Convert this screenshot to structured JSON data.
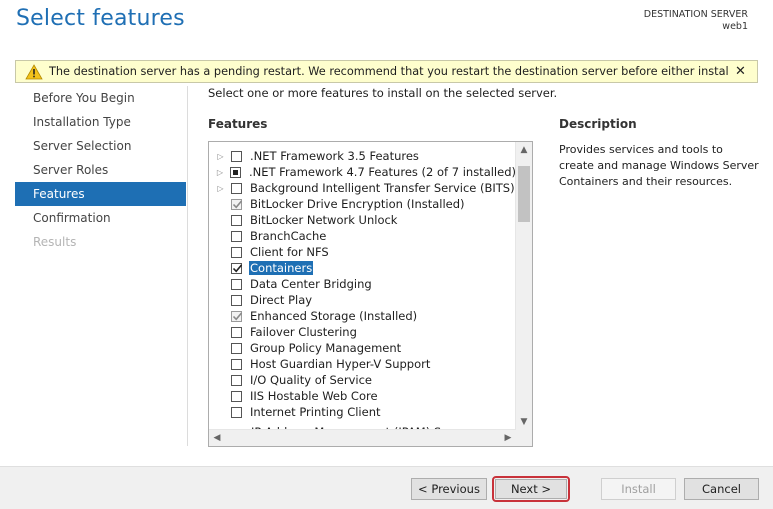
{
  "header": {
    "title": "Select features",
    "destination_label": "DESTINATION SERVER",
    "destination_server": "web1"
  },
  "warning": {
    "icon": "warning-icon",
    "text": "The destination server has a pending restart. We recommend that you restart the destination server before either installing or...",
    "close_label": "✕"
  },
  "nav": {
    "items": [
      {
        "label": "Before You Begin",
        "state": "normal"
      },
      {
        "label": "Installation Type",
        "state": "normal"
      },
      {
        "label": "Server Selection",
        "state": "normal"
      },
      {
        "label": "Server Roles",
        "state": "normal"
      },
      {
        "label": "Features",
        "state": "active"
      },
      {
        "label": "Confirmation",
        "state": "normal"
      },
      {
        "label": "Results",
        "state": "disabled"
      }
    ]
  },
  "main": {
    "instruction": "Select one or more features to install on the selected server.",
    "features_heading": "Features",
    "description_heading": "Description",
    "description_text": "Provides services and tools to create and manage Windows Server Containers and their resources.",
    "features": [
      {
        "label": ".NET Framework 3.5 Features",
        "expandable": true,
        "check": "unchecked",
        "selected": false
      },
      {
        "label": ".NET Framework 4.7 Features (2 of 7 installed)",
        "expandable": true,
        "check": "partial",
        "selected": false
      },
      {
        "label": "Background Intelligent Transfer Service (BITS)",
        "expandable": true,
        "check": "unchecked",
        "selected": false
      },
      {
        "label": "BitLocker Drive Encryption (Installed)",
        "expandable": false,
        "check": "installed",
        "selected": false
      },
      {
        "label": "BitLocker Network Unlock",
        "expandable": false,
        "check": "unchecked",
        "selected": false
      },
      {
        "label": "BranchCache",
        "expandable": false,
        "check": "unchecked",
        "selected": false
      },
      {
        "label": "Client for NFS",
        "expandable": false,
        "check": "unchecked",
        "selected": false
      },
      {
        "label": "Containers",
        "expandable": false,
        "check": "checked",
        "selected": true
      },
      {
        "label": "Data Center Bridging",
        "expandable": false,
        "check": "unchecked",
        "selected": false
      },
      {
        "label": "Direct Play",
        "expandable": false,
        "check": "unchecked",
        "selected": false
      },
      {
        "label": "Enhanced Storage (Installed)",
        "expandable": false,
        "check": "installed",
        "selected": false
      },
      {
        "label": "Failover Clustering",
        "expandable": false,
        "check": "unchecked",
        "selected": false
      },
      {
        "label": "Group Policy Management",
        "expandable": false,
        "check": "unchecked",
        "selected": false
      },
      {
        "label": "Host Guardian Hyper-V Support",
        "expandable": false,
        "check": "unchecked",
        "selected": false
      },
      {
        "label": "I/O Quality of Service",
        "expandable": false,
        "check": "unchecked",
        "selected": false
      },
      {
        "label": "IIS Hostable Web Core",
        "expandable": false,
        "check": "unchecked",
        "selected": false
      },
      {
        "label": "Internet Printing Client",
        "expandable": false,
        "check": "unchecked",
        "selected": false
      }
    ],
    "cut_off_row": "IP Address Management (IPAM) Server"
  },
  "footer": {
    "previous_label": "< Previous",
    "next_label": "Next >",
    "install_label": "Install",
    "cancel_label": "Cancel"
  },
  "colors": {
    "title": "#1f6fb4",
    "accent": "#1e6fb4",
    "warning_bg": "#fefecd",
    "next_highlight": "#c8323a"
  }
}
